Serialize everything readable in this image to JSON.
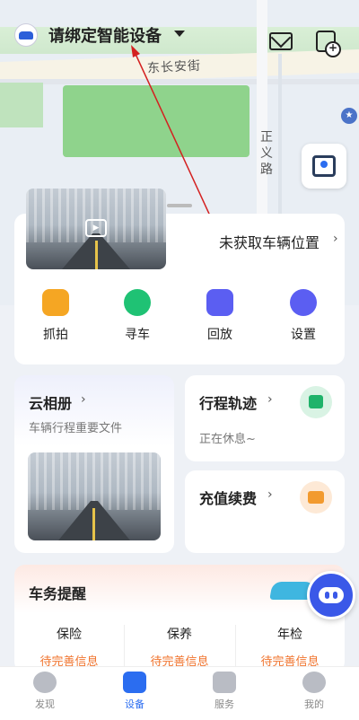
{
  "header": {
    "title": "请绑定智能设备"
  },
  "map": {
    "labels": [
      "东长安街",
      "正",
      "义",
      "路"
    ]
  },
  "device_card": {
    "location_text": "未获取车辆位置",
    "functions": [
      {
        "label": "抓拍",
        "icon": "camera-snap-icon",
        "color": "#f5a623"
      },
      {
        "label": "寻车",
        "icon": "find-car-icon",
        "color": "#1fc274"
      },
      {
        "label": "回放",
        "icon": "playback-icon",
        "color": "#5b5ef2"
      },
      {
        "label": "设置",
        "icon": "gear-icon",
        "color": "#5b5ef2"
      }
    ]
  },
  "album": {
    "title": "云相册",
    "subtitle": "车辆行程重要文件"
  },
  "trip": {
    "title": "行程轨迹",
    "status": "正在休息~"
  },
  "recharge": {
    "title": "充值续费"
  },
  "reminder": {
    "title": "车务提醒",
    "items": [
      {
        "label": "保险",
        "status": "待完善信息"
      },
      {
        "label": "保养",
        "status": "待完善信息"
      },
      {
        "label": "年检",
        "status": "待完善信息"
      }
    ]
  },
  "tabs": [
    {
      "label": "发现"
    },
    {
      "label": "设备"
    },
    {
      "label": "服务"
    },
    {
      "label": "我的"
    }
  ],
  "colors": {
    "accent": "#2b6df0",
    "warning": "#f0742e"
  }
}
